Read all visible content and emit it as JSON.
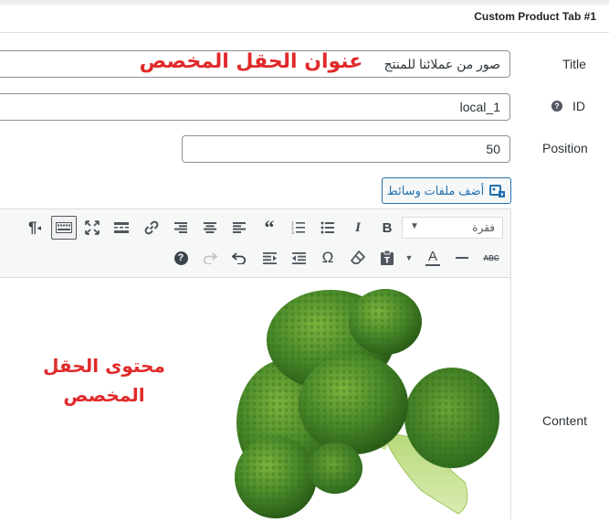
{
  "panel": {
    "title": "Custom Product Tab #1"
  },
  "fields": {
    "title": {
      "label": "Title",
      "value": "صور من عملائنا للمنتج",
      "annotation": "عنوان الحقل المخصص"
    },
    "id": {
      "label": "ID",
      "value": "local_1"
    },
    "position": {
      "label": "Position",
      "value": "50"
    },
    "content": {
      "label": "Content",
      "annotation_line1": "محتوى الحقل",
      "annotation_line2": "المخصص"
    }
  },
  "media_button": {
    "label": "أضف ملفات وسائط"
  },
  "editor": {
    "format_select": {
      "value": "فقرة"
    },
    "row1_icons": [
      "format-select",
      "bold-icon",
      "italic-icon",
      "bullet-list-icon",
      "numbered-list-icon",
      "blockquote-icon",
      "align-left-icon",
      "align-center-icon",
      "align-right-icon",
      "link-icon",
      "read-more-icon",
      "fullscreen-icon",
      "toolbar-toggle-icon",
      "paragraph-mark-icon"
    ],
    "row2_icons": [
      "strikethrough-icon",
      "horizontal-line-icon",
      "text-color-icon",
      "paste-text-icon",
      "clear-formatting-icon",
      "special-character-icon",
      "outdent-icon",
      "indent-icon",
      "undo-icon",
      "redo-icon",
      "help-icon"
    ]
  },
  "colors": {
    "annotation": "#e02a2a",
    "accent": "#2271b1",
    "broccoli_dark": "#2f6b1f",
    "broccoli_light": "#9fcf55"
  }
}
